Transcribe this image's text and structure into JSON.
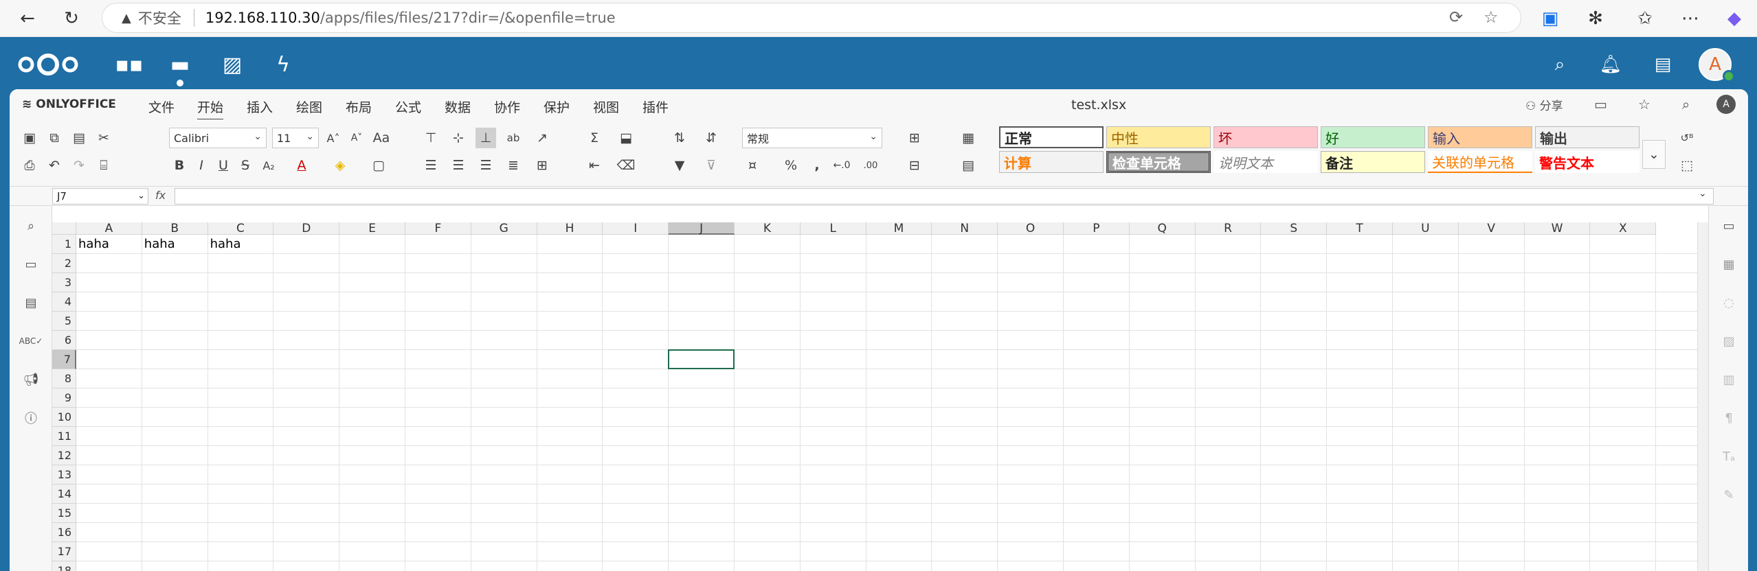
{
  "browser": {
    "insecure_label": "不安全",
    "url_host": "192.168.110.30",
    "url_path": "/apps/files/files/217?dir=/&openfile=true"
  },
  "nextcloud": {
    "avatar_letter": "A"
  },
  "office": {
    "logo_text": "ONLYOFFICE",
    "tabs": [
      "文件",
      "开始",
      "插入",
      "绘图",
      "布局",
      "公式",
      "数据",
      "协作",
      "保护",
      "视图",
      "插件"
    ],
    "active_tab": "开始",
    "document_title": "test.xlsx",
    "share_label": "分享",
    "user_letter": "A"
  },
  "toolbar": {
    "font_name": "Calibri",
    "font_size": "11",
    "number_format": "常规",
    "styles_row1": [
      "正常",
      "中性",
      "坏",
      "好",
      "输入",
      "输出"
    ],
    "styles_row2": [
      "计算",
      "检查单元格",
      "说明文本",
      "备注",
      "关联的单元格",
      "警告文本"
    ]
  },
  "formula_bar": {
    "name_box": "J7",
    "fx_label": "fx",
    "formula": ""
  },
  "sheet": {
    "columns": [
      "A",
      "B",
      "C",
      "D",
      "E",
      "F",
      "G",
      "H",
      "I",
      "J",
      "K",
      "L",
      "M",
      "N",
      "O",
      "P",
      "Q",
      "R",
      "S",
      "T",
      "U",
      "V",
      "W",
      "X"
    ],
    "rows": [
      "1",
      "2",
      "3",
      "4",
      "5",
      "6",
      "7",
      "8",
      "9",
      "10",
      "11",
      "12",
      "13",
      "14",
      "15",
      "16",
      "17",
      "18"
    ],
    "selected_column": "J",
    "selected_row": "7",
    "cells": [
      {
        "ref": "A1",
        "value": "haha"
      },
      {
        "ref": "B1",
        "value": "haha"
      },
      {
        "ref": "C1",
        "value": "haha"
      }
    ]
  }
}
